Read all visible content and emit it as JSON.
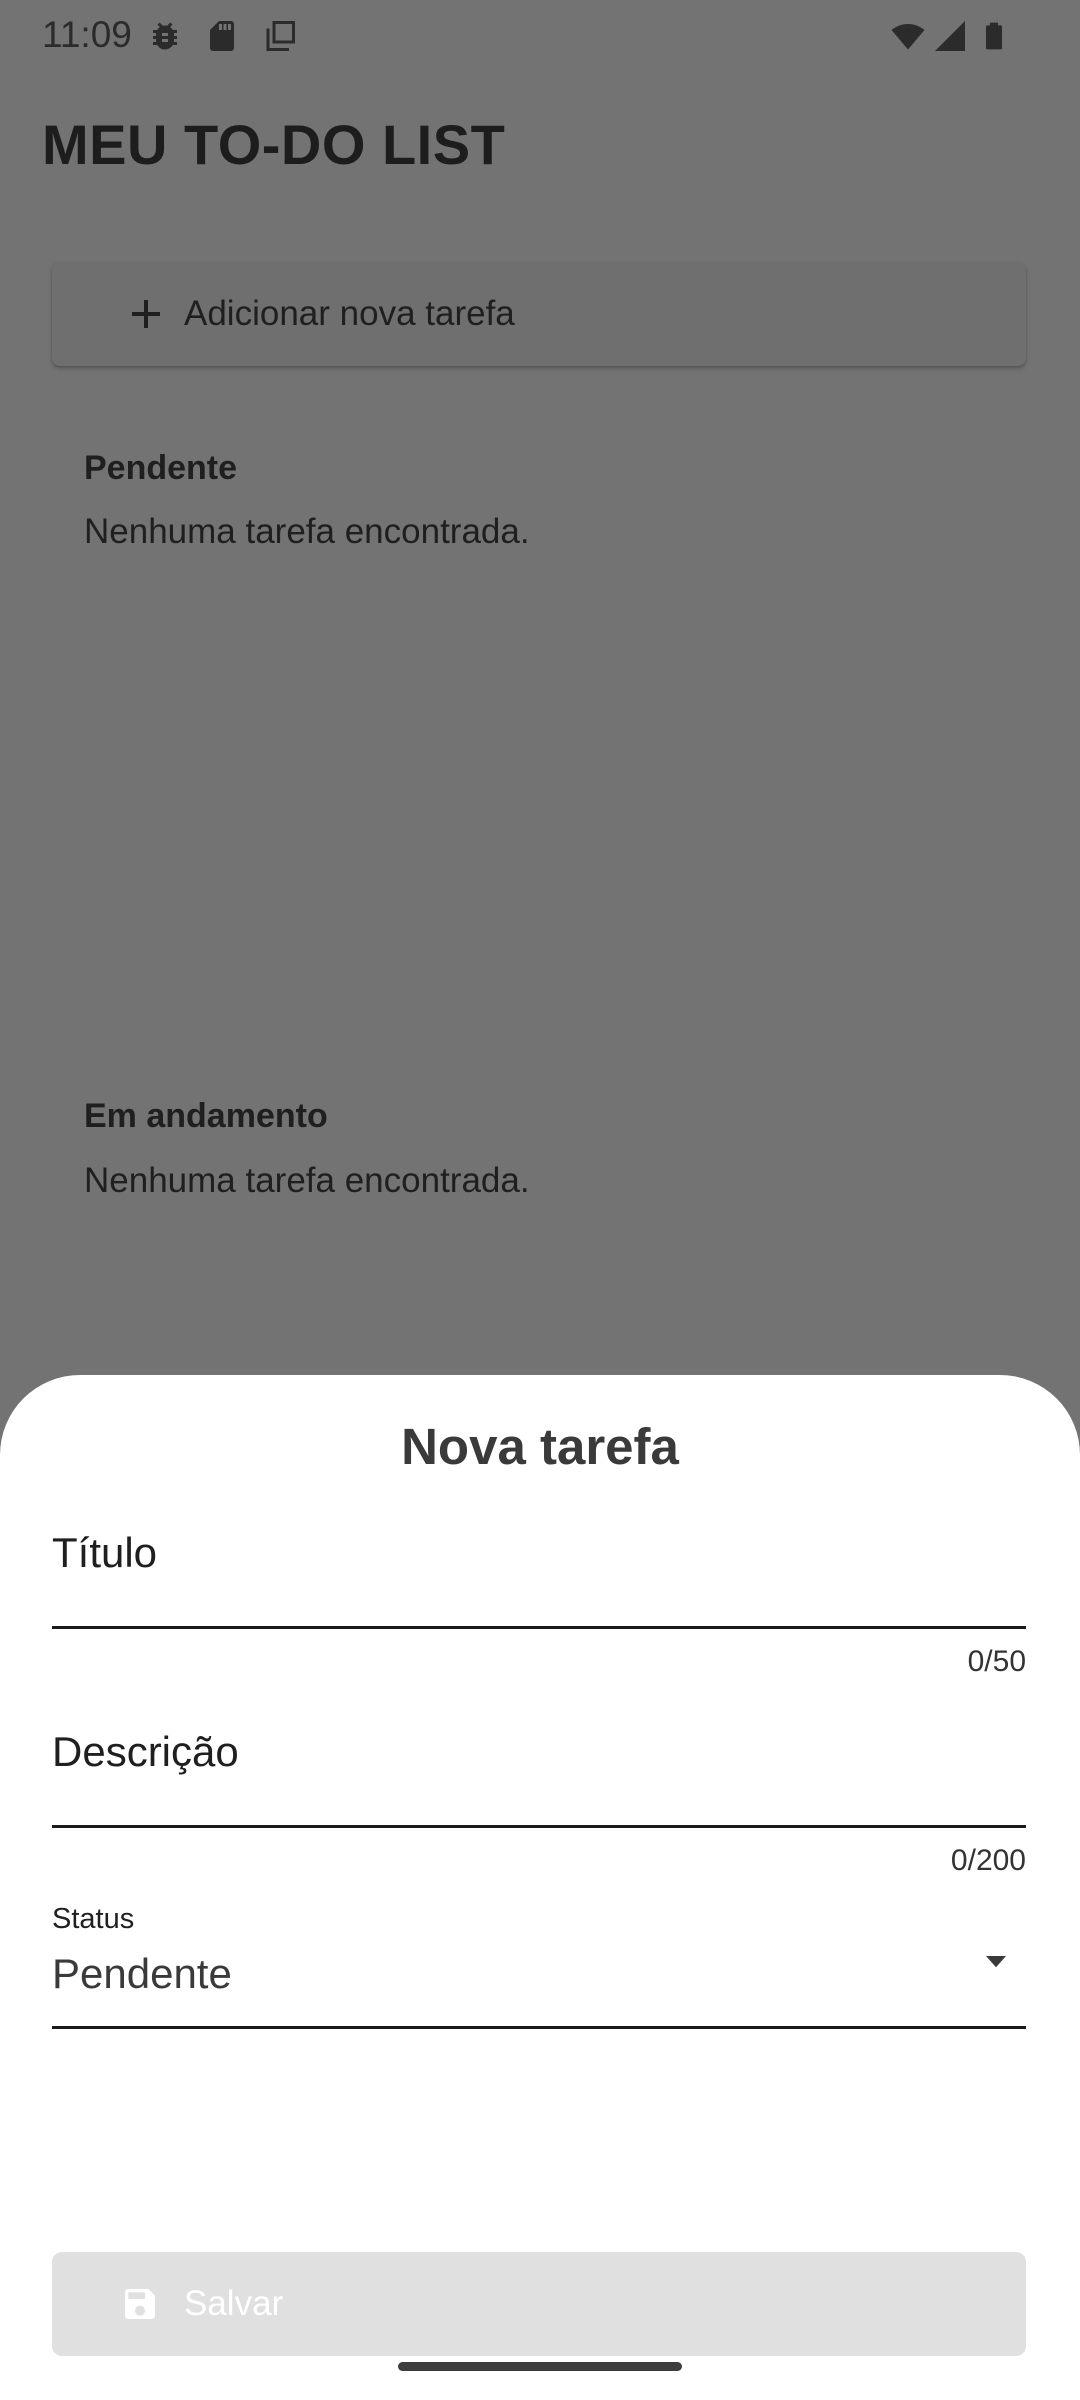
{
  "statusbar": {
    "time": "11:09",
    "left_icons": [
      "bug-icon",
      "sd-card-icon",
      "copy-icon"
    ],
    "right_icons": [
      "wifi-icon",
      "signal-icon",
      "battery-icon"
    ]
  },
  "app": {
    "title": "MEU TO-DO LIST",
    "add_task_label": "Adicionar nova tarefa",
    "sections": [
      {
        "title": "Pendente",
        "empty_text": "Nenhuma tarefa encontrada."
      },
      {
        "title": "Em andamento",
        "empty_text": "Nenhuma tarefa encontrada."
      }
    ]
  },
  "sheet": {
    "title": "Nova tarefa",
    "title_field": {
      "label": "Título",
      "counter": "0/50"
    },
    "description_field": {
      "label": "Descrição",
      "counter": "0/200"
    },
    "status_field": {
      "caption": "Status",
      "value": "Pendente"
    },
    "save_label": "Salvar"
  },
  "colors": {
    "scrim": "#737373",
    "sheet": "#ffffff",
    "disabled_button": "#e0e0e0"
  }
}
